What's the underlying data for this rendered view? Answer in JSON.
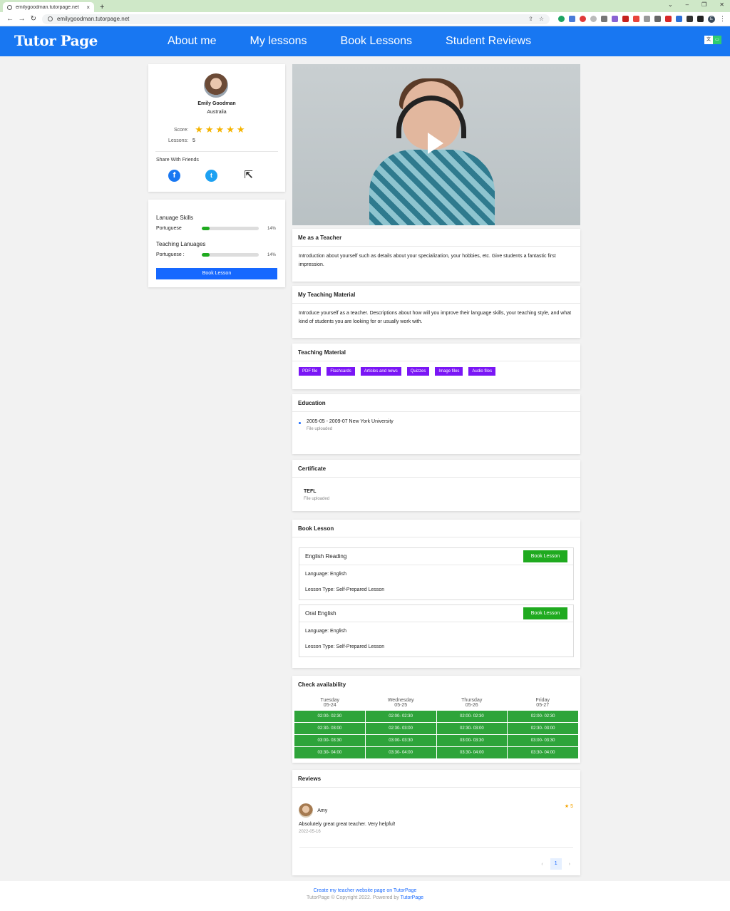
{
  "browser": {
    "tab_title": "emilygoodman.tutorpage.net",
    "tab_close": "×",
    "new_tab": "+",
    "url": "emilygoodman.tutorpage.net",
    "profile_initial": "E"
  },
  "header": {
    "logo": "Tutor Page",
    "nav": [
      "About me",
      "My lessons",
      "Book Lessons",
      "Student Reviews"
    ],
    "brand_color": "#1877f2"
  },
  "profile": {
    "name": "Emily Goodman",
    "country": "Australia",
    "score_label": "Score:",
    "stars": "★★★★★",
    "lessons_label": "Lessons:",
    "lessons_count": "5",
    "share_label": "Share With Friends"
  },
  "skills": {
    "language_title": "Lanuage Skills",
    "language_name": "Portuguese",
    "language_pct": "14%",
    "teaching_title": "Teaching Lanuages",
    "teaching_name": "Portuguese :",
    "teaching_pct": "14%",
    "book_button": "Book Lesson"
  },
  "sections": {
    "teacher_title": "Me as a Teacher",
    "teacher_text": "Introduction about yourself such as details about your specialization, your hobbies, etc. Give students a fantastic first impression.",
    "material_desc_title": "My Teaching Material",
    "material_desc_text": "Introduce yourself as a teacher. Descriptions about how will you improve their language skills, your teaching style, and what kind of students you are looking for or usually work with.",
    "material_title": "Teaching Material",
    "material_tags": [
      "PDF file",
      "Flashcards",
      "Articles and news",
      "Quizzes",
      "Image files",
      "Audio files"
    ],
    "education_title": "Education",
    "education_item": "2005-05 - 2009-07 New York University",
    "education_note": "File uploaded",
    "certificate_title": "Certificate",
    "certificate_name": "TEFL",
    "certificate_note": "File uploaded"
  },
  "book_lesson": {
    "title": "Book Lesson",
    "lessons": [
      {
        "name": "English Reading",
        "button": "Book Lesson",
        "language": "Language:  English",
        "type": "Lesson Type:  Self-Prepared Lesson"
      },
      {
        "name": "Oral English",
        "button": "Book Lesson",
        "language": "Language:  English",
        "type": "Lesson Type:  Self-Prepared Lesson"
      }
    ]
  },
  "availability": {
    "title": "Check availability",
    "days": [
      {
        "day": "Tuesday",
        "date": "05-24"
      },
      {
        "day": "Wednesday",
        "date": "05-25"
      },
      {
        "day": "Thursday",
        "date": "05-26"
      },
      {
        "day": "Friday",
        "date": "05-27"
      }
    ],
    "slots": [
      "02:00- 02:30",
      "02:30- 03:00",
      "03:00- 03:30",
      "03:30- 04:00"
    ]
  },
  "reviews": {
    "title": "Reviews",
    "author": "Amy",
    "score": "★ 5",
    "text": "Absolutely great great teacher. Very helpful!",
    "date": "2022-05-16",
    "page": "1",
    "prev": "‹",
    "next": "›"
  },
  "footer": {
    "link": "Create my teacher website page on TutorPage",
    "copyright": "TutorPage © Copyright 2022. Powered by ",
    "powered": "TutorPage"
  }
}
